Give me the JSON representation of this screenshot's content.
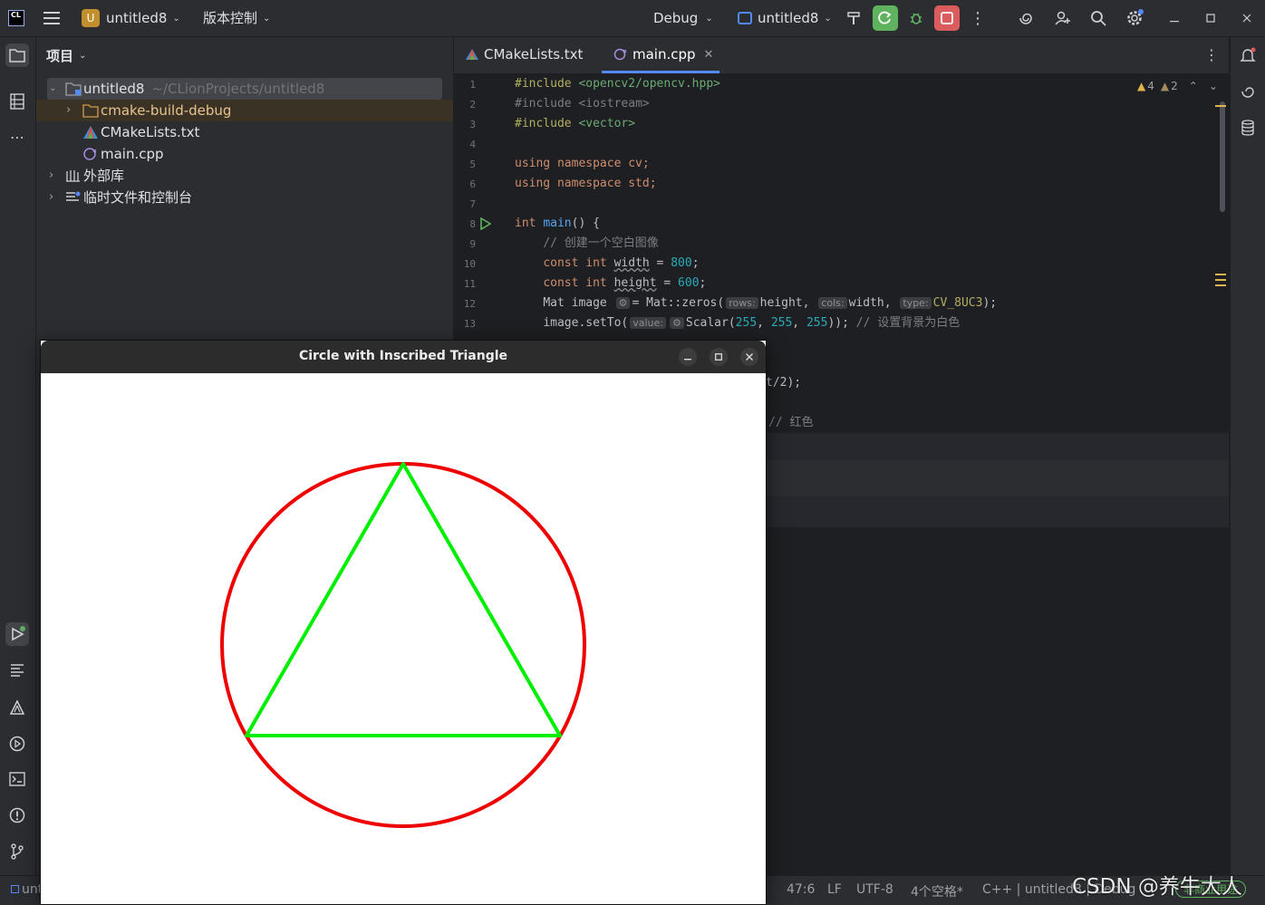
{
  "topbar": {
    "logo": "CL",
    "project_badge": "U",
    "project_name": "untitled8",
    "vcs_menu": "版本控制",
    "run_config": "Debug",
    "target_name": "untitled8",
    "icons": [
      "hamburger-menu-icon",
      "hammer-icon",
      "rerun-icon",
      "debug-icon",
      "stop-icon",
      "more-icon",
      "ai-spiral-icon",
      "add-user-icon",
      "search-icon",
      "settings-icon",
      "minimize-icon",
      "maximize-icon",
      "close-icon"
    ],
    "colors": {
      "run_green": "#5fb35f",
      "stop_red": "#db5c5c"
    }
  },
  "project_panel": {
    "title": "项目",
    "root": {
      "name": "untitled8",
      "path": "~/CLionProjects/untitled8"
    },
    "items": [
      {
        "name": "cmake-build-debug",
        "kind": "folder"
      },
      {
        "name": "CMakeLists.txt",
        "kind": "cmake"
      },
      {
        "name": "main.cpp",
        "kind": "cpp"
      }
    ],
    "external_libs": "外部库",
    "scratches": "临时文件和控制台"
  },
  "editor": {
    "tabs": [
      {
        "label": "CMakeLists.txt",
        "active": false
      },
      {
        "label": "main.cpp",
        "active": true
      }
    ],
    "warnings": "4",
    "weak_warnings": "2",
    "line_numbers": [
      "1",
      "2",
      "3",
      "4",
      "5",
      "6",
      "7",
      "8",
      "9",
      "10",
      "11",
      "12",
      "13"
    ],
    "code": {
      "l1_pp": "#include",
      "l1_str": "<opencv2/opencv.hpp>",
      "l2_pp": "#include",
      "l2_str": "<iostream>",
      "l3_pp": "#include",
      "l3_str": "<vector>",
      "l5": "using namespace cv;",
      "l6": "using namespace std;",
      "l8_kw": "int",
      "l8_fn": "main",
      "l8_rest": "() {",
      "l9": "// 创建一个空白图像",
      "l10_kw": "const int",
      "l10_id": "width",
      "l10_eq": " = ",
      "l10_num": "800",
      "l10_end": ";",
      "l11_kw": "const int",
      "l11_id": "height",
      "l11_eq": " = ",
      "l11_num": "600",
      "l11_end": ";",
      "l12_a": "Mat image ",
      "l12_b": "= Mat::zeros(",
      "l12_h1": "rows:",
      "l12_c": "height, ",
      "l12_h2": "cols:",
      "l12_d": "width, ",
      "l12_h3": "type:",
      "l12_e": "CV_8UC3",
      "l12_f": ");",
      "l13_a": "image.setTo(",
      "l13_h1": "value:",
      "l13_b": "Scalar(",
      "l13_n1": "255",
      "l13_n2": "255",
      "l13_n3": "255",
      "l13_c": ")); ",
      "l13_cmt": "// 设置背景为白色",
      "frag1": "t/2);",
      "frag2": "// 红色"
    }
  },
  "popup": {
    "title": "Circle with Inscribed Triangle",
    "colors": {
      "circle": "#ee0000",
      "triangle": "#00ee00"
    }
  },
  "statusbar": {
    "left": "unt",
    "pos": "47:6",
    "eol": "LF",
    "encoding": "UTF-8",
    "indent": "4个空格*",
    "context": "C++ | untitled8 | Debug",
    "watermark": "CSDN @养牛大人",
    "plugin": "非商业用途"
  }
}
